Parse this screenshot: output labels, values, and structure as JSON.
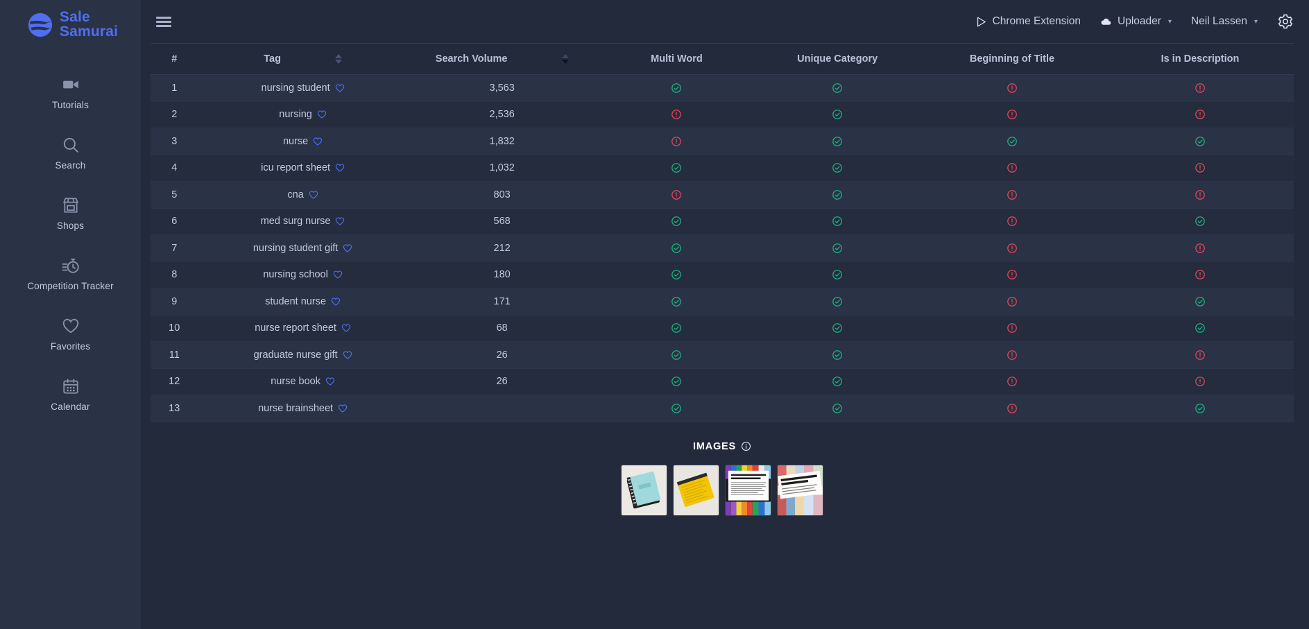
{
  "brand": {
    "name_line1": "Sale",
    "name_line2": "Samurai",
    "accent": "#4f6ef2"
  },
  "sidebar": {
    "items": [
      {
        "label": "Tutorials",
        "icon": "video-camera-icon"
      },
      {
        "label": "Search",
        "icon": "search-icon"
      },
      {
        "label": "Shops",
        "icon": "store-icon"
      },
      {
        "label": "Competition Tracker",
        "icon": "stopwatch-icon"
      },
      {
        "label": "Favorites",
        "icon": "heart-icon"
      },
      {
        "label": "Calendar",
        "icon": "calendar-icon"
      }
    ]
  },
  "topbar": {
    "menu_icon": "hamburger-icon",
    "chrome_extension": "Chrome Extension",
    "uploader": "Uploader",
    "user": "Neil Lassen",
    "chevron": "∨",
    "settings_icon": "gear-icon"
  },
  "table": {
    "columns": [
      {
        "key": "num",
        "label": "#",
        "sortable": false
      },
      {
        "key": "tag",
        "label": "Tag",
        "sortable": true,
        "sort_state": "none"
      },
      {
        "key": "vol",
        "label": "Search Volume",
        "sortable": true,
        "sort_state": "desc"
      },
      {
        "key": "mw",
        "label": "Multi Word",
        "sortable": false
      },
      {
        "key": "uc",
        "label": "Unique Category",
        "sortable": false
      },
      {
        "key": "bot",
        "label": "Beginning of Title",
        "sortable": false
      },
      {
        "key": "iid",
        "label": "Is in Description",
        "sortable": false
      }
    ],
    "rows": [
      {
        "num": "1",
        "tag": "nursing student",
        "vol": "3,563",
        "mw": true,
        "uc": true,
        "bot": false,
        "iid": false
      },
      {
        "num": "2",
        "tag": "nursing",
        "vol": "2,536",
        "mw": false,
        "uc": true,
        "bot": false,
        "iid": false
      },
      {
        "num": "3",
        "tag": "nurse",
        "vol": "1,832",
        "mw": false,
        "uc": true,
        "bot": true,
        "iid": true
      },
      {
        "num": "4",
        "tag": "icu report sheet",
        "vol": "1,032",
        "mw": true,
        "uc": true,
        "bot": false,
        "iid": false
      },
      {
        "num": "5",
        "tag": "cna",
        "vol": "803",
        "mw": false,
        "uc": true,
        "bot": false,
        "iid": false
      },
      {
        "num": "6",
        "tag": "med surg nurse",
        "vol": "568",
        "mw": true,
        "uc": true,
        "bot": false,
        "iid": true
      },
      {
        "num": "7",
        "tag": "nursing student gift",
        "vol": "212",
        "mw": true,
        "uc": true,
        "bot": false,
        "iid": false
      },
      {
        "num": "8",
        "tag": "nursing school",
        "vol": "180",
        "mw": true,
        "uc": true,
        "bot": false,
        "iid": false
      },
      {
        "num": "9",
        "tag": "student nurse",
        "vol": "171",
        "mw": true,
        "uc": true,
        "bot": false,
        "iid": true
      },
      {
        "num": "10",
        "tag": "nurse report sheet",
        "vol": "68",
        "mw": true,
        "uc": true,
        "bot": false,
        "iid": true
      },
      {
        "num": "11",
        "tag": "graduate nurse gift",
        "vol": "26",
        "mw": true,
        "uc": true,
        "bot": false,
        "iid": false
      },
      {
        "num": "12",
        "tag": "nurse book",
        "vol": "26",
        "mw": true,
        "uc": true,
        "bot": false,
        "iid": false
      },
      {
        "num": "13",
        "tag": "nurse brainsheet",
        "vol": "",
        "mw": true,
        "uc": true,
        "bot": false,
        "iid": true
      }
    ],
    "favorite_icon": "heart-outline-icon",
    "ok_icon": "check-circle-icon",
    "bad_icon": "exclamation-circle-icon",
    "ok_color": "#1db47f",
    "bad_color": "#e0495b"
  },
  "images": {
    "title": "IMAGES",
    "info_icon": "info-circle-icon",
    "thumbs": [
      {
        "name": "teal-spiral-notebook-thumbnail"
      },
      {
        "name": "yellow-spiral-notebook-thumbnail"
      },
      {
        "name": "report-cover-instructions-thumbnail"
      },
      {
        "name": "personalize-your-report-thumbnail"
      }
    ]
  }
}
